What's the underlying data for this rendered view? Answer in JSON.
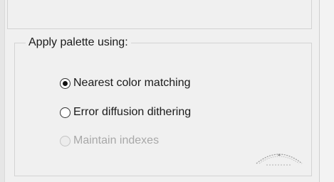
{
  "group": {
    "title": "Apply palette using:",
    "options": [
      {
        "label": "Nearest color matching",
        "selected": true,
        "enabled": true
      },
      {
        "label": "Error diffusion dithering",
        "selected": false,
        "enabled": true
      },
      {
        "label": "Maintain indexes",
        "selected": false,
        "enabled": false
      }
    ]
  },
  "colors": {
    "background": "#f0f0f0",
    "border": "#d3d3d3",
    "disabled_text": "#a8a8a8"
  }
}
